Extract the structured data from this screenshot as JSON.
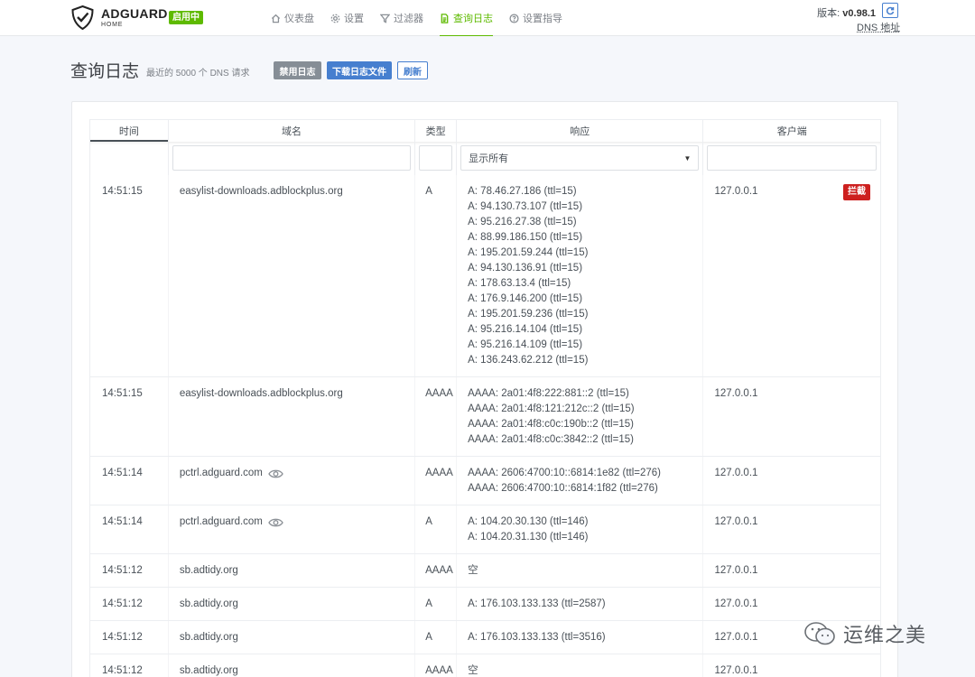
{
  "header": {
    "brand": "ADGUARD",
    "brand_sub": "HOME",
    "status_badge": "启用中",
    "nav": [
      {
        "label": "仪表盘",
        "icon": "home-icon"
      },
      {
        "label": "设置",
        "icon": "gear-icon"
      },
      {
        "label": "过滤器",
        "icon": "filter-icon"
      },
      {
        "label": "查询日志",
        "icon": "document-icon",
        "active": true
      },
      {
        "label": "设置指导",
        "icon": "help-icon"
      }
    ],
    "version_label": "版本: ",
    "version": "v0.98.1",
    "dns_address": "DNS 地址"
  },
  "page": {
    "title": "查询日志",
    "subtitle": "最近的 5000 个 DNS 请求",
    "btn_disable": "禁用日志",
    "btn_download": "下载日志文件",
    "btn_refresh": "刷新"
  },
  "table": {
    "columns": [
      "时间",
      "域名",
      "类型",
      "响应",
      "客户端"
    ],
    "filter_response": "显示所有",
    "block_label": "拦截",
    "rows": [
      {
        "time": "14:51:15",
        "domain": "easylist-downloads.adblockplus.org",
        "type": "A",
        "client": "127.0.0.1",
        "eye": false,
        "block": true,
        "response": [
          "A: 78.46.27.186 (ttl=15)",
          "A: 94.130.73.107 (ttl=15)",
          "A: 95.216.27.38 (ttl=15)",
          "A: 88.99.186.150 (ttl=15)",
          "A: 195.201.59.244 (ttl=15)",
          "A: 94.130.136.91 (ttl=15)",
          "A: 178.63.13.4 (ttl=15)",
          "A: 176.9.146.200 (ttl=15)",
          "A: 195.201.59.236 (ttl=15)",
          "A: 95.216.14.104 (ttl=15)",
          "A: 95.216.14.109 (ttl=15)",
          "A: 136.243.62.212 (ttl=15)"
        ]
      },
      {
        "time": "14:51:15",
        "domain": "easylist-downloads.adblockplus.org",
        "type": "AAAA",
        "client": "127.0.0.1",
        "eye": false,
        "block": false,
        "response": [
          "AAAA: 2a01:4f8:222:881::2 (ttl=15)",
          "AAAA: 2a01:4f8:121:212c::2 (ttl=15)",
          "AAAA: 2a01:4f8:c0c:190b::2 (ttl=15)",
          "AAAA: 2a01:4f8:c0c:3842::2 (ttl=15)"
        ]
      },
      {
        "time": "14:51:14",
        "domain": "pctrl.adguard.com",
        "type": "AAAA",
        "client": "127.0.0.1",
        "eye": true,
        "block": false,
        "response": [
          "AAAA: 2606:4700:10::6814:1e82 (ttl=276)",
          "AAAA: 2606:4700:10::6814:1f82 (ttl=276)"
        ]
      },
      {
        "time": "14:51:14",
        "domain": "pctrl.adguard.com",
        "type": "A",
        "client": "127.0.0.1",
        "eye": true,
        "block": false,
        "response": [
          "A: 104.20.30.130 (ttl=146)",
          "A: 104.20.31.130 (ttl=146)"
        ]
      },
      {
        "time": "14:51:12",
        "domain": "sb.adtidy.org",
        "type": "AAAA",
        "client": "127.0.0.1",
        "eye": false,
        "block": false,
        "response": [
          "空"
        ]
      },
      {
        "time": "14:51:12",
        "domain": "sb.adtidy.org",
        "type": "A",
        "client": "127.0.0.1",
        "eye": false,
        "block": false,
        "response": [
          "A: 176.103.133.133 (ttl=2587)"
        ]
      },
      {
        "time": "14:51:12",
        "domain": "sb.adtidy.org",
        "type": "A",
        "client": "127.0.0.1",
        "eye": false,
        "block": false,
        "response": [
          "A: 176.103.133.133 (ttl=3516)"
        ]
      },
      {
        "time": "14:51:12",
        "domain": "sb.adtidy.org",
        "type": "AAAA",
        "client": "127.0.0.1",
        "eye": false,
        "block": false,
        "response": [
          "空"
        ]
      }
    ]
  },
  "watermark": {
    "text": "运维之美",
    "icon": "wechat-icon"
  },
  "colors": {
    "accent": "#5eba00",
    "primary": "#467fcf",
    "danger": "#cd201f",
    "secondary": "#868e96"
  }
}
